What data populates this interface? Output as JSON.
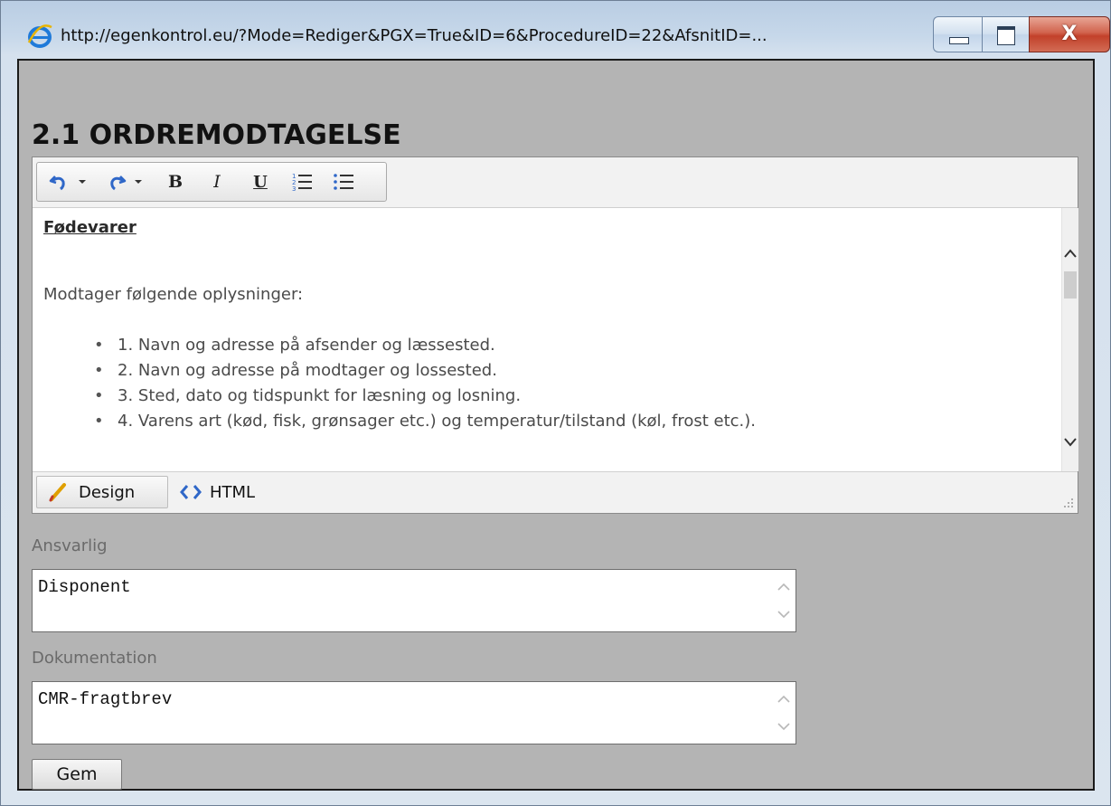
{
  "window": {
    "title": "http://egenkontrol.eu/?Mode=Rediger&PGX=True&ID=6&ProcedureID=22&AfsnitID=...",
    "close_glyph": "X"
  },
  "page": {
    "title": "2.1 ORDREMODTAGELSE"
  },
  "toolbar": {
    "bold": "B",
    "italic": "I",
    "underline": "U"
  },
  "editor": {
    "heading": "Fødevarer",
    "intro": "Modtager følgende oplysninger:",
    "items": [
      "1. Navn og adresse på afsender og læssested.",
      "2. Navn og adresse på modtager og lossested.",
      "3. Sted, dato og tidspunkt for læsning og losning.",
      "4. Varens art (kød, fisk, grønsager etc.) og temperatur/tilstand (køl, frost etc.)."
    ],
    "modes": {
      "design": "Design",
      "html": "HTML"
    }
  },
  "form": {
    "responsible": {
      "label": "Ansvarlig",
      "value": "Disponent"
    },
    "documentation": {
      "label": "Dokumentation",
      "value": "CMR-fragtbrev"
    },
    "save_label": "Gem"
  },
  "colors": {
    "content_bg": "#b4b4b4",
    "close_red": "#c2412a",
    "ie_blue": "#1f7ad9"
  },
  "icons": {
    "browser": "ie-logo-icon",
    "undo": "undo-icon",
    "redo": "redo-icon",
    "ordered_list": "ordered-list-icon",
    "unordered_list": "unordered-list-icon",
    "design": "pencil-icon",
    "html": "code-brackets-icon"
  }
}
